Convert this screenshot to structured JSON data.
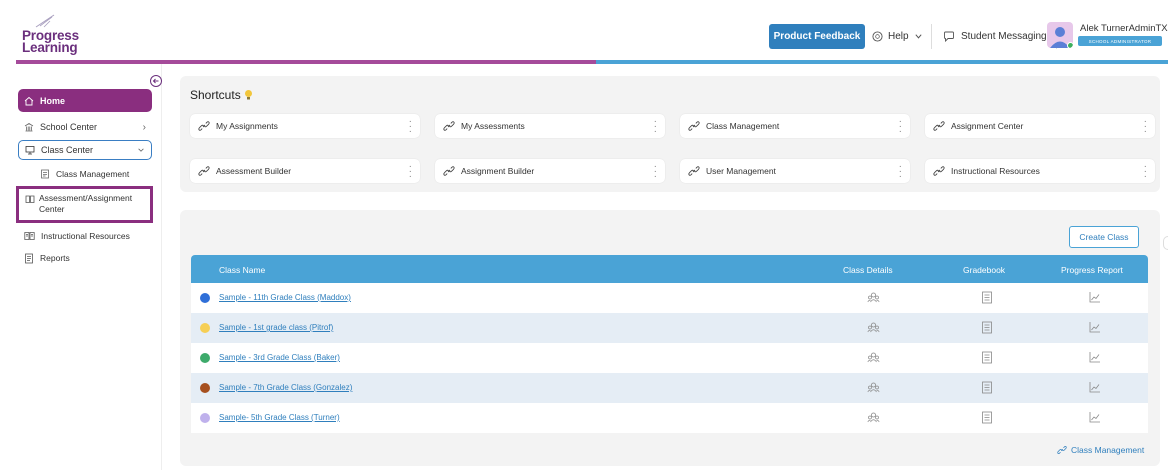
{
  "brand": {
    "line1": "Progress",
    "line2": "Learning"
  },
  "header": {
    "feedback_label": "Product Feedback",
    "help_label": "Help",
    "messaging_label": "Student Messaging",
    "user_name": "Alek TurnerAdminTX",
    "user_role": "SCHOOL ADMINISTRATOR"
  },
  "sidebar": {
    "home": "Home",
    "school_center": "School Center",
    "class_center": "Class Center",
    "class_management": "Class Management",
    "assessment_center_line1": "Assessment/Assignment",
    "assessment_center_line2": "Center",
    "instructional_resources": "Instructional Resources",
    "reports": "Reports"
  },
  "shortcuts": {
    "title": "Shortcuts",
    "items": [
      {
        "label": "My Assignments"
      },
      {
        "label": "My Assessments"
      },
      {
        "label": "Class Management"
      },
      {
        "label": "Assignment Center"
      },
      {
        "label": "Assessment Builder"
      },
      {
        "label": "Assignment Builder"
      },
      {
        "label": "User Management"
      },
      {
        "label": "Instructional Resources"
      }
    ]
  },
  "classes": {
    "create_label": "Create Class",
    "columns": {
      "name": "Class Name",
      "details": "Class Details",
      "gradebook": "Gradebook",
      "progress": "Progress Report"
    },
    "rows": [
      {
        "name": "Sample - 11th Grade Class (Maddox)",
        "color": "#2f6fd8"
      },
      {
        "name": "Sample - 1st grade class (Pitrof)",
        "color": "#f6cf55"
      },
      {
        "name": "Sample - 3rd Grade Class (Baker)",
        "color": "#3daa6b"
      },
      {
        "name": "Sample - 7th Grade Class (Gonzalez)",
        "color": "#a6501f"
      },
      {
        "name": "Sample- 5th Grade Class (Turner)",
        "color": "#bfb1ec"
      }
    ],
    "footer_link": "Class Management"
  },
  "colors": {
    "brand_purple": "#8a2e7f",
    "accent_blue": "#4aa3d6",
    "button_blue": "#2f7fbd"
  }
}
